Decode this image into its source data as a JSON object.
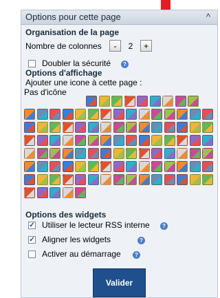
{
  "header": {
    "title": "Options pour cette page",
    "collapse_icon": "^"
  },
  "layout_section": {
    "title": "Organisation de la page",
    "columns_label": "Nombre de colonnes",
    "minus": "-",
    "columns_value": "2",
    "plus": "+",
    "double_security_label": "Doubler la sécurité",
    "double_security_checked": false
  },
  "display_section": {
    "title": "Options d'affichage",
    "add_icon_label": "Ajouter une icone à cette page :",
    "no_icon_label": "Pas d'icône"
  },
  "widgets_section": {
    "title": "Options des widgets",
    "items": [
      {
        "label": "Utiliser le lecteur RSS interne",
        "checked": true
      },
      {
        "label": "Aligner les widgets",
        "checked": true
      },
      {
        "label": "Activer au démarrage",
        "checked": false
      }
    ]
  },
  "submit_label": "Valider",
  "help_symbol": "?",
  "colors": {
    "accent": "#1f4f8c",
    "arrow": "#e31e24",
    "panel_bg": "#eef2f7",
    "icon_palette": [
      "#3d7dd8",
      "#f0b43a",
      "#5fb85a",
      "#e0522d",
      "#8c6bc8",
      "#2fb0c8",
      "#d9d9d9",
      "#c94a9a",
      "#9bc34b",
      "#f28b2d",
      "#6a8db3",
      "#e94f4f"
    ]
  }
}
